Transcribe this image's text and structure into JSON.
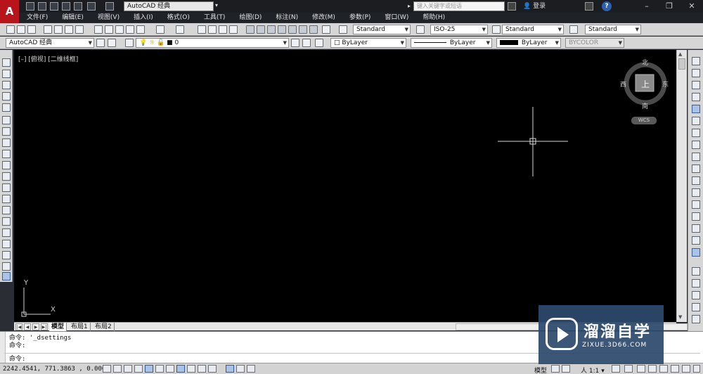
{
  "titlebar": {
    "workspace": "AutoCAD 经典",
    "search_placeholder": "键入关键字或短语",
    "login": "登录",
    "help": "?"
  },
  "menu": [
    "文件(F)",
    "编辑(E)",
    "视图(V)",
    "插入(I)",
    "格式(O)",
    "工具(T)",
    "绘图(D)",
    "标注(N)",
    "修改(M)",
    "参数(P)",
    "窗口(W)",
    "帮助(H)"
  ],
  "toolbar1": {
    "text_style": "Standard",
    "dim_style": "ISO-25",
    "table_style": "Standard",
    "multileader_style": "Standard"
  },
  "toolbar2": {
    "workspace": "AutoCAD 经典",
    "layer": "0",
    "color": "ByLayer",
    "linetype": "ByLayer",
    "lineweight": "ByLayer",
    "plotstyle": "BYCOLOR"
  },
  "drawing": {
    "viewport_label": "[–] [俯视] [二维线框]",
    "viewcube": {
      "north": "北",
      "south": "南",
      "east": "东",
      "west": "西",
      "face": "上",
      "wcs": "WCS"
    },
    "ucs": {
      "x": "X",
      "y": "Y"
    }
  },
  "tabs": [
    "模型",
    "布局1",
    "布局2"
  ],
  "command": {
    "lines": [
      "命令: '_dsettings",
      "命令:"
    ],
    "prompt": "命令:"
  },
  "statusbar": {
    "coords": "2242.4541, 771.3863 , 0.0000",
    "model": "模型",
    "scale": "人 1:1 ▾"
  },
  "watermark": {
    "title": "溜溜自学",
    "url": "ZIXUE.3D66.COM"
  },
  "colors": {
    "title_bg": "#1b1d21",
    "toolbar_bg": "#d6d6d6",
    "canvas_bg": "#000000",
    "logo_red": "#b8141b"
  }
}
